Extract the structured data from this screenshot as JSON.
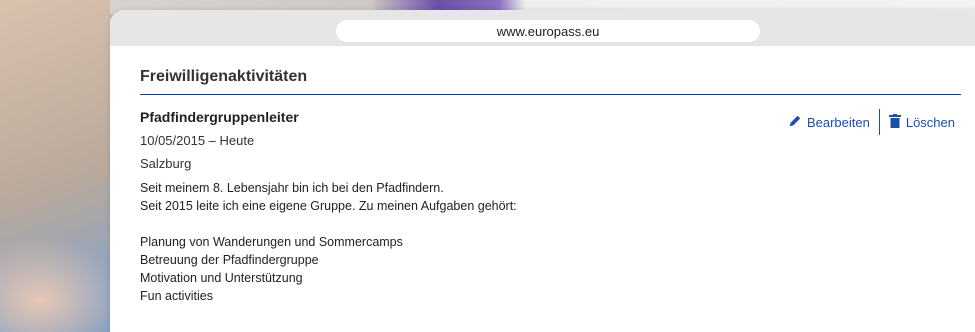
{
  "browser": {
    "url": "www.europass.eu"
  },
  "section": {
    "title": "Freiwilligenaktivitäten"
  },
  "entry": {
    "title": "Pfadfindergruppenleiter",
    "date": "10/05/2015 – Heute",
    "place": "Salzburg",
    "description_lines_1": [
      "Seit meinem 8. Lebensjahr bin ich bei den Pfadfindern.",
      "Seit 2015 leite ich eine eigene Gruppe. Zu meinen Aufgaben gehört:"
    ],
    "description_lines_2": [
      "Planung von Wanderungen und Sommercamps",
      "Betreuung der Pfadfindergruppe",
      "Motivation und Unterstützung",
      "Fun activities"
    ]
  },
  "actions": {
    "edit_label": "Bearbeiten",
    "edit_icon": "pencil-icon",
    "delete_label": "Löschen",
    "delete_icon": "trash-icon",
    "color": "#1f4ea8"
  }
}
